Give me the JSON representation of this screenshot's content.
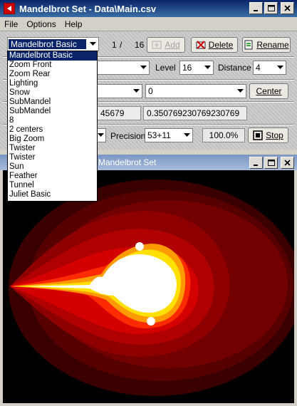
{
  "window": {
    "title": "Mandelbrot Set - Data\\Main.csv"
  },
  "menu": [
    "File",
    "Options",
    "Help"
  ],
  "toolbar": {
    "preset_value": "Mandelbrot Basic",
    "index": "1",
    "slash": "/",
    "total": "16",
    "add_label": "Add",
    "delete_label": "Delete",
    "rename_label": "Rename"
  },
  "row2": {
    "level_label": "Level",
    "level_value": "16",
    "distance_label": "Distance",
    "distance_value": "4"
  },
  "row3": {
    "second_value": "0",
    "center_label": "Center"
  },
  "row4": {
    "field1": "45679",
    "field2": "0.350769230769230769"
  },
  "row5": {
    "precision_label": "Precision",
    "precision_value": "53+11",
    "zoom_pct": "100.0%",
    "stop_label": "Stop"
  },
  "dropdown_items": [
    "Mandelbrot Basic",
    "Zoom Front",
    "Zoom Rear",
    "Lighting",
    "Snow",
    "SubMandel",
    "SubMandel",
    "8",
    "2 centers",
    "Big Zoom",
    "Twister",
    "Twister",
    "Sun",
    "Feather",
    "Tunnel",
    "Juliet Basic"
  ],
  "child": {
    "title": "Mandelbrot Set"
  },
  "colors": {
    "title_active": "#0a246a",
    "title_inactive": "#7a96c2",
    "fractal_outer": "#5a0000",
    "fractal_mid": "#d40000",
    "fractal_edge": "#ffd000",
    "fractal_core": "#ffffff"
  }
}
